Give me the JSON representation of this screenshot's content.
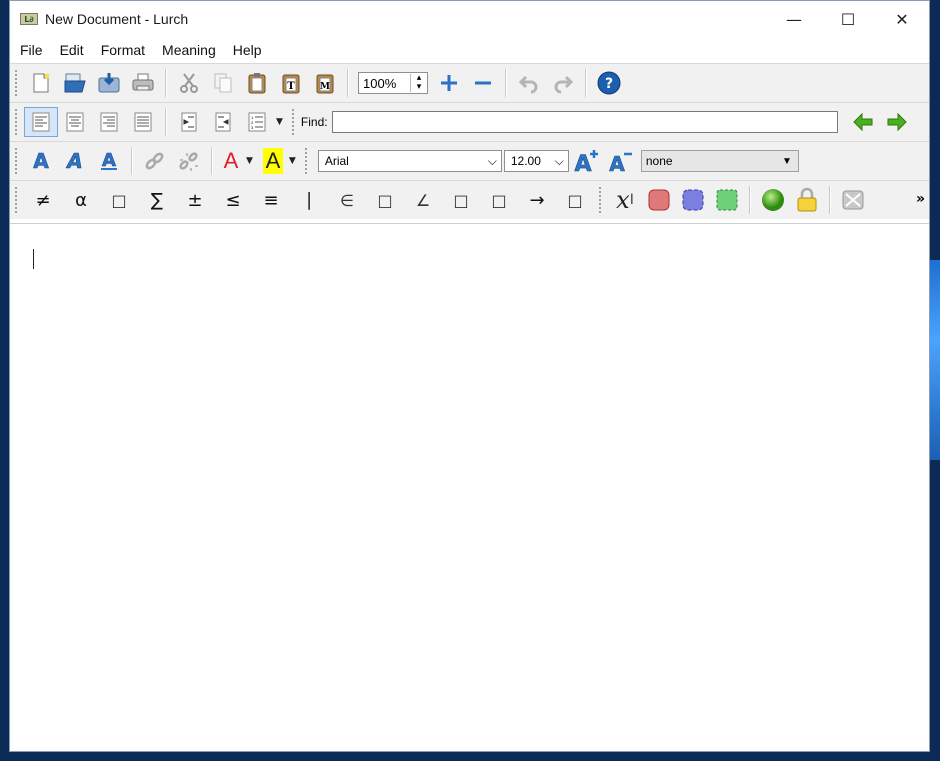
{
  "window": {
    "title": "New Document - Lurch",
    "app_icon_text": "L∂"
  },
  "window_controls": {
    "minimize": "—",
    "maximize": "☐",
    "close": "✕"
  },
  "menu": [
    "File",
    "Edit",
    "Format",
    "Meaning",
    "Help"
  ],
  "toolbar1": {
    "zoom_value": "100%"
  },
  "toolbar2": {
    "find_label": "Find:",
    "find_value": ""
  },
  "toolbar3": {
    "font_family": "Arial",
    "font_size": "12.00",
    "meaning_type": "none",
    "text_color_glyph": "A",
    "highlight_glyph": "A"
  },
  "symbols": [
    "≠",
    "α",
    "□",
    "∑",
    "±",
    "≤",
    "≡",
    "∣",
    "∈",
    "□",
    "∠",
    "□",
    "□",
    "→",
    "□"
  ],
  "toolbar4": {
    "variable_glyph": "x",
    "overflow": "»"
  },
  "colors": {
    "accent_blue": "#1a66c9",
    "green_arrow": "#4caf22",
    "red_bubble": "#e07a7a",
    "blue_bubble": "#7b7fe0",
    "green_bubble": "#6fd07a",
    "text_color_red": "#e0202a",
    "highlight_yellow": "#ffff00"
  }
}
